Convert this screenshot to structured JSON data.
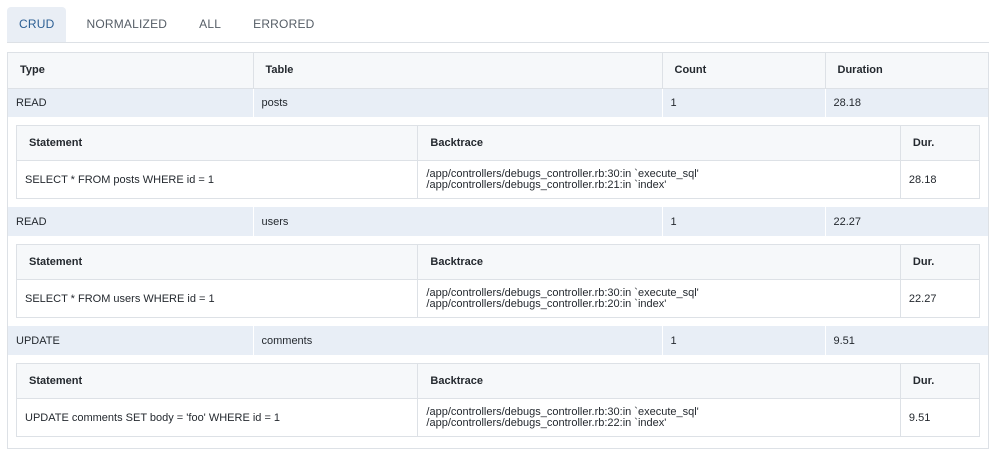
{
  "tabs": [
    {
      "label": "CRUD",
      "active": true
    },
    {
      "label": "NORMALIZED",
      "active": false
    },
    {
      "label": "ALL",
      "active": false
    },
    {
      "label": "ERRORED",
      "active": false
    }
  ],
  "columns": {
    "type": "Type",
    "table": "Table",
    "count": "Count",
    "duration": "Duration"
  },
  "inner_columns": {
    "statement": "Statement",
    "backtrace": "Backtrace",
    "dur": "Dur."
  },
  "queries": [
    {
      "type": "READ",
      "table": "posts",
      "count": "1",
      "duration": "28.18",
      "statement": "SELECT * FROM posts WHERE id = 1",
      "backtrace": [
        "/app/controllers/debugs_controller.rb:30:in `execute_sql'",
        "/app/controllers/debugs_controller.rb:21:in `index'"
      ],
      "dur": "28.18"
    },
    {
      "type": "READ",
      "table": "users",
      "count": "1",
      "duration": "22.27",
      "statement": "SELECT * FROM users WHERE id = 1",
      "backtrace": [
        "/app/controllers/debugs_controller.rb:30:in `execute_sql'",
        "/app/controllers/debugs_controller.rb:20:in `index'"
      ],
      "dur": "22.27"
    },
    {
      "type": "UPDATE",
      "table": "comments",
      "count": "1",
      "duration": "9.51",
      "statement": "UPDATE comments SET body = 'foo' WHERE id = 1",
      "backtrace": [
        "/app/controllers/debugs_controller.rb:30:in `execute_sql'",
        "/app/controllers/debugs_controller.rb:22:in `index'"
      ],
      "dur": "9.51"
    }
  ]
}
